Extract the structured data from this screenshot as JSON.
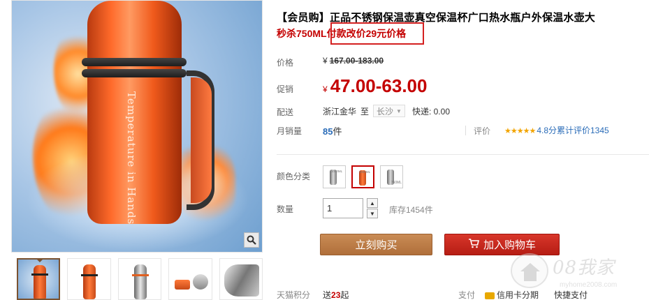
{
  "product": {
    "title": "【会员购】正品不锈钢保温壶真空保温杯广口热水瓶户外保温水壶大",
    "subtitle": "秒杀750ML付款改价29元价格",
    "bottle_text": "Temperature in Hands"
  },
  "price": {
    "label": "价格",
    "currency": "¥",
    "original": "167.00-183.00",
    "promo_label": "促销",
    "promo": "47.00-63.00"
  },
  "shipping": {
    "label": "配送",
    "from": "浙江金华",
    "to_word": "至",
    "destination": "长沙",
    "fee": "快递: 0.00"
  },
  "sales": {
    "label": "月销量",
    "count": "85",
    "unit": "件"
  },
  "rating": {
    "label": "评价",
    "stars": "★★★★★",
    "score": "4.8分",
    "count_label": "累计评价1345"
  },
  "options": {
    "color_label": "颜色分类",
    "swatches": [
      {
        "caption": "1000ML"
      },
      {
        "caption": "1000ML"
      },
      {
        "caption": "750ML"
      }
    ],
    "selected_index": 1
  },
  "quantity": {
    "label": "数量",
    "value": "1",
    "stock": "库存1454件"
  },
  "buttons": {
    "buy_now": "立刻购买",
    "add_to_cart": "加入购物车"
  },
  "footer": {
    "points_label": "天猫积分",
    "points_prefix": "送",
    "points_value": "23",
    "points_suffix": "起",
    "payment_label": "支付",
    "payment_credit": "信用卡分期",
    "payment_quick": "快捷支付"
  },
  "watermark": {
    "text": "08我家",
    "url": "myhome2008.com"
  },
  "colors": {
    "price_red": "#c40000",
    "link_blue": "#2a6cb8",
    "buy_brown": "#b06f3a",
    "cart_red": "#c8281e",
    "star_gold": "#f2a400"
  }
}
